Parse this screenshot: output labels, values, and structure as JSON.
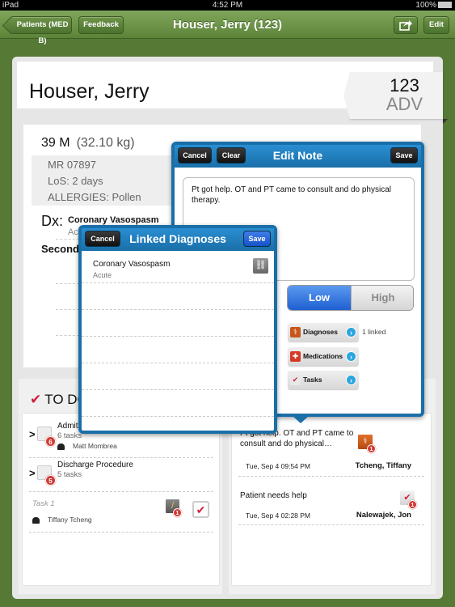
{
  "statusbar": {
    "device": "iPad",
    "time": "4:52 PM",
    "battery": "100%"
  },
  "navbar": {
    "back_label": "Patients (MED B)",
    "feedback_label": "Feedback",
    "title": "Houser, Jerry (123)",
    "share_icon": "share-icon",
    "edit_label": "Edit"
  },
  "patient": {
    "name": "Houser, Jerry",
    "room": "123",
    "status": "ADV",
    "age_sex": "39 M",
    "weight": "(32.10 kg)",
    "mr": "MR  07897",
    "los": "LoS:  2 days",
    "allergies": "ALLERGIES:  Pollen",
    "dx_label": "Dx:",
    "dx_name": "Coronary Vasospasm",
    "dx_sub": "Acute",
    "secondary_label": "Secondary"
  },
  "todo": {
    "title": "TO DO",
    "items": [
      {
        "title": "Admit patient",
        "sub": "6 tasks",
        "badge": "6",
        "person": "Matt Mombrea"
      },
      {
        "title": "Discharge Procedure",
        "sub": "5 tasks",
        "badge": "5"
      },
      {
        "title": "Task 1",
        "person": "Tiffany Tcheng",
        "note_badge": "1"
      }
    ]
  },
  "notes": {
    "items": [
      {
        "text": "Pt got help. OT and PT came to consult and do physical…",
        "date": "Tue, Sep 4 09:54 PM",
        "author": "Tcheng, Tiffany",
        "badge": "1"
      },
      {
        "text": "Patient needs help",
        "date": "Tue, Sep 4 02:28 PM",
        "author": "Nalewajek, Jon",
        "badge": "1"
      }
    ]
  },
  "edit_note": {
    "title": "Edit Note",
    "cancel_label": "Cancel",
    "clear_label": "Clear",
    "save_label": "Save",
    "note_text": "Pt got help. OT and PT came to consult and do physical therapy.",
    "priority": {
      "options": [
        "Low",
        "High"
      ],
      "selected": "Low"
    },
    "links": [
      {
        "label": "Diagnoses",
        "count": "1 linked",
        "color": "#c8561c"
      },
      {
        "label": "Medications",
        "color": "#d63a25"
      },
      {
        "label": "Tasks",
        "color": "#e8e8e8"
      }
    ]
  },
  "linked_diagnoses": {
    "title": "Linked Diagnoses",
    "cancel_label": "Cancel",
    "save_label": "Save",
    "items": [
      {
        "name": "Coronary Vasospasm",
        "sub": "Acute",
        "linked": true
      }
    ]
  },
  "colors": {
    "nav_green": "#5c8438",
    "popover_blue": "#1a6fa8",
    "accent_red": "#d0213a"
  }
}
